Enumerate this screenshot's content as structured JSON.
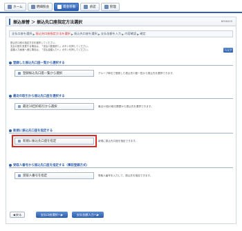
{
  "nav": {
    "tabs": [
      {
        "label": "ホーム",
        "icon": "home-icon",
        "active": false
      },
      {
        "label": "明細照会",
        "icon": "document-icon",
        "active": false
      },
      {
        "label": "資金移動",
        "icon": "transfer-icon",
        "active": true
      },
      {
        "label": "承認",
        "icon": "check-icon",
        "active": false
      },
      {
        "label": "管理",
        "icon": "gear-icon",
        "active": false
      }
    ]
  },
  "page": {
    "title": "振込振替 ＞ 振込先口座指定方法選択",
    "code": "BFKK003"
  },
  "steps": [
    {
      "label": "支払口座を選択",
      "current": false
    },
    {
      "label": "振込先口座指定方法を選択",
      "current": true
    },
    {
      "label": "振込先口座を選択",
      "current": false
    },
    {
      "label": "支払金額を入力",
      "current": false
    },
    {
      "label": "内容確認",
      "current": false
    },
    {
      "label": "確定",
      "current": false
    }
  ],
  "intro": {
    "line1": "振込先口座の指定方法を選択してください。",
    "line2": "支払口座を変更する場合は、「支払口座選択へ」ボタンを押してください。",
    "line3": "金額入力画面へ進む場合は、「支払金額入力へ」ボタンを押してください。"
  },
  "help_label": "ヘルプ",
  "sections": [
    {
      "heading": "登録した振込先口座一覧から選択する",
      "button": "登録振込先口座一覧から選択",
      "description": "グループ単位で登録した振込先口座一覧から振込先を選択できます。"
    },
    {
      "heading": "最近の取引から振込先口座を選択する",
      "button": "最近10回の取引から選択",
      "description": "最近10回の取引履歴から振込先を選択できます。"
    },
    {
      "heading": "新規に振込先口座を指定する",
      "button": "新規に振込先口座を指定",
      "description": "新規に振込先口座を指定できます。"
    },
    {
      "heading": "受取人番号から振込先口座を指定する（事前登録方式）",
      "button": "受取人番号を指定",
      "description": "受取人番号を入力して、振込先を指定できます。"
    }
  ],
  "footer": {
    "back": "戻る",
    "to_payment_account": "支払口座選択へ",
    "to_amount_input": "支払金額入力へ"
  },
  "colors": {
    "accent": "#2f5fae",
    "highlight": "#d62a22",
    "current_step": "#d9302b"
  }
}
